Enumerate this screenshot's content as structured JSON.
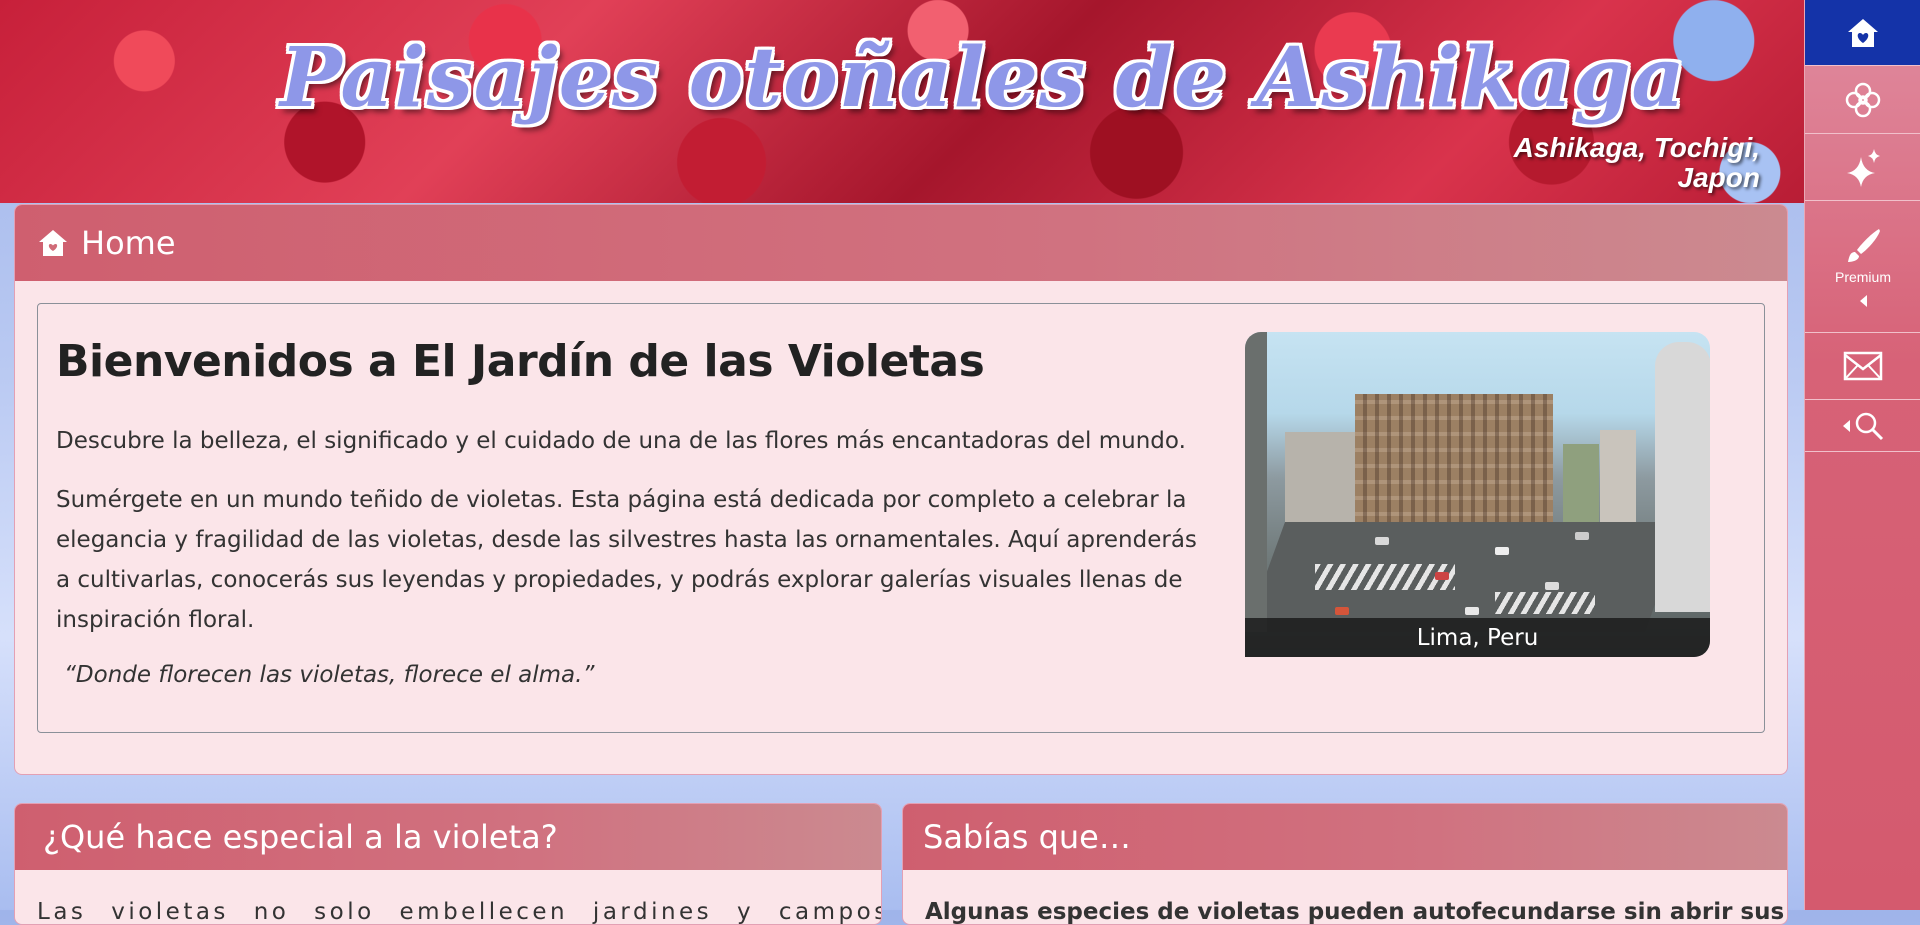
{
  "banner": {
    "title": "Paisajes otoñales de Ashikaga",
    "location_line1": "Ashikaga, Tochigi,",
    "location_line2": "Japon"
  },
  "sidebar": {
    "items": [
      {
        "icon": "home-heart-icon"
      },
      {
        "icon": "flower-icon"
      },
      {
        "icon": "sparkle-icon"
      },
      {
        "icon": "brush-icon",
        "label": "Premium"
      },
      {
        "icon": "mail-icon"
      },
      {
        "icon": "search-icon"
      }
    ],
    "active_color": "#1433a8"
  },
  "main": {
    "header": {
      "icon": "home-icon",
      "label": "Home"
    },
    "title": "Bienvenidos a El Jardín de las Violetas",
    "subtitle": "Descubre la belleza, el significado y el cuidado de una de las flores más encantadoras del mundo.",
    "paragraph_line1": "Sumérgete en un mundo teñido de violetas. Esta página está dedicada por completo a celebrar la",
    "paragraph_line2": "elegancia y fragilidad de las violetas, desde las silvestres hasta las ornamentales. Aquí aprenderás",
    "paragraph_line3": "a cultivarlas, conocerás sus leyendas y propiedades, y podrás explorar galerías visuales llenas de",
    "paragraph_line4": "inspiración floral.",
    "quote": "“Donde florecen las violetas, florece el alma.”",
    "photo": {
      "caption": "Lima, Peru"
    }
  },
  "cards": [
    {
      "title": "¿Qué hace especial a la violeta?",
      "text": "Las violetas no solo embellecen jardines y campos; también"
    },
    {
      "title": "Sabías que…",
      "text": "Algunas especies de violetas pueden autofecundarse sin abrir sus"
    }
  ],
  "colors": {
    "header_gradient": "#cf5f6f",
    "panel_bg": "#fbe5e9",
    "title_color": "#8e97e8"
  }
}
